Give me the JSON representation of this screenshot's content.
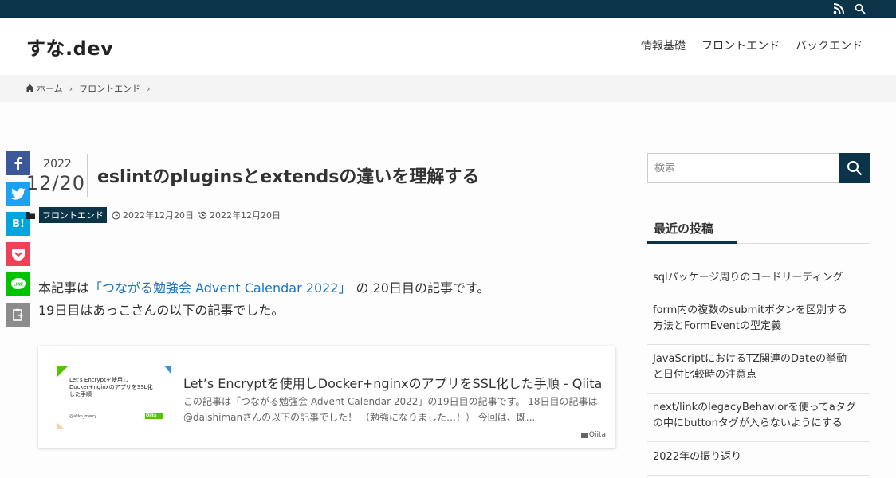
{
  "topbar": {
    "rss_icon": "rss-icon",
    "search_icon": "search-icon"
  },
  "header": {
    "site_title": "すな.dev",
    "nav": [
      "情報基礎",
      "フロントエンド",
      "バックエンド"
    ]
  },
  "breadcrumb": {
    "home": "ホーム",
    "category": "フロントエンド"
  },
  "share": {
    "hatena_label": "B!",
    "icons": [
      "facebook-icon",
      "twitter-icon",
      "hatena-icon",
      "pocket-icon",
      "line-icon",
      "copy-icon"
    ]
  },
  "article": {
    "date_year": "2022",
    "date_md": "12/20",
    "title": "eslintのpluginsとextendsの違いを理解する",
    "category": "フロントエンド",
    "published": "2022年12月20日",
    "updated": "2022年12月20日",
    "body": {
      "line1_prefix": "本記事は",
      "line1_link": "「つながる勉強会 Advent Calendar 2022」",
      "line1_suffix": "の 20日目の記事です。",
      "line2": "19日目はあっこさんの以下の記事でした。"
    },
    "card": {
      "title": "Let’s Encryptを使用しDocker+nginxのアプリをSSL化した手順 - Qiita",
      "desc": "この記事は「つながる勉強会 Advent Calendar 2022」の19日目の記事です。 18日目の記事は@daishimanさんの以下の記事でした！ （勉強になりました…！） 今回は、既...",
      "source": "Qiita",
      "thumb_line1": "Let’s Encryptを使用し",
      "thumb_line2": "Docker+nginxのアプリをSSL化",
      "thumb_line3": "した手順",
      "thumb_author": "@akko_merry",
      "thumb_badge": "Qiita"
    }
  },
  "sidebar": {
    "search_placeholder": "検索",
    "recent_title": "最近の投稿",
    "posts": [
      {
        "line1": "sqlパッケージ周りのコードリーディング",
        "line2": ""
      },
      {
        "line1": "form内の複数のsubmitボタンを区別する",
        "line2": "方法とFormEventの型定義"
      },
      {
        "line1": "JavaScriptにおけるTZ関連のDateの挙動",
        "line2": "と日付比較時の注意点"
      },
      {
        "line1": "next/linkのlegacyBehaviorを使ってaタグ",
        "line2": "の中にbuttonタグが入らないようにする"
      },
      {
        "line1": "2022年の振り返り",
        "line2": ""
      }
    ]
  },
  "colors": {
    "brand": "#0b3448",
    "link": "#1e73be",
    "facebook": "#3b5998",
    "twitter": "#1da1f2",
    "hatena": "#00a4de",
    "pocket": "#ef4056",
    "line": "#00c300",
    "copy": "#8c8c8c"
  }
}
